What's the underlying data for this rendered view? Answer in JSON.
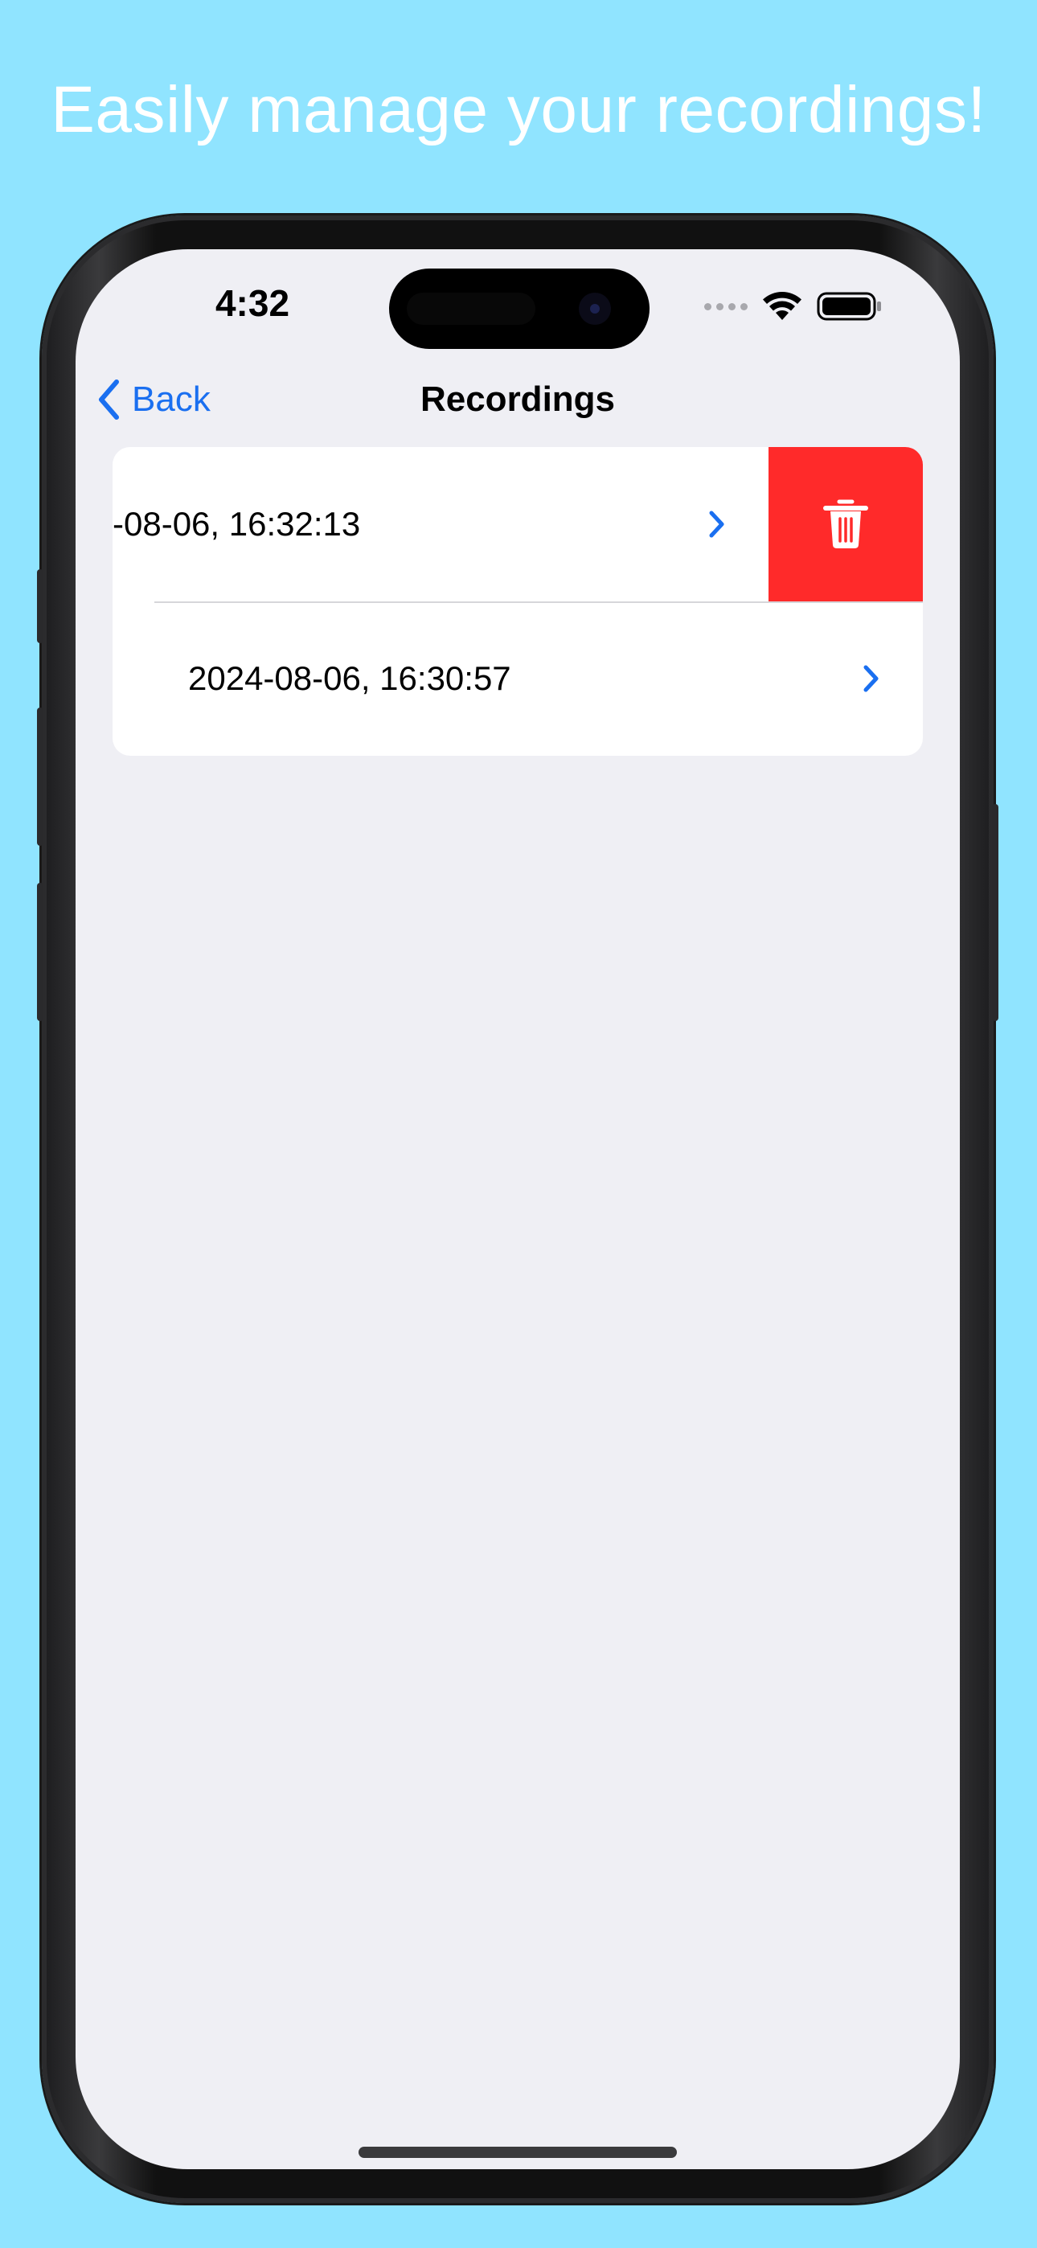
{
  "headline": "Easily manage your recordings!",
  "status_bar": {
    "time": "4:32",
    "icons": [
      "cellular-signal-icon",
      "wifi-icon",
      "battery-icon"
    ]
  },
  "nav": {
    "back_label": "Back",
    "title": "Recordings"
  },
  "recordings": [
    {
      "label": "-08-06, 16:32:13",
      "swiped": true
    },
    {
      "label": "2024-08-06, 16:30:57",
      "swiped": false
    }
  ],
  "actions": {
    "delete_icon": "trash-icon"
  },
  "colors": {
    "background": "#90e4ff",
    "screen": "#efeff4",
    "accent": "#1a6ff0",
    "destructive": "#ff2a2a"
  }
}
